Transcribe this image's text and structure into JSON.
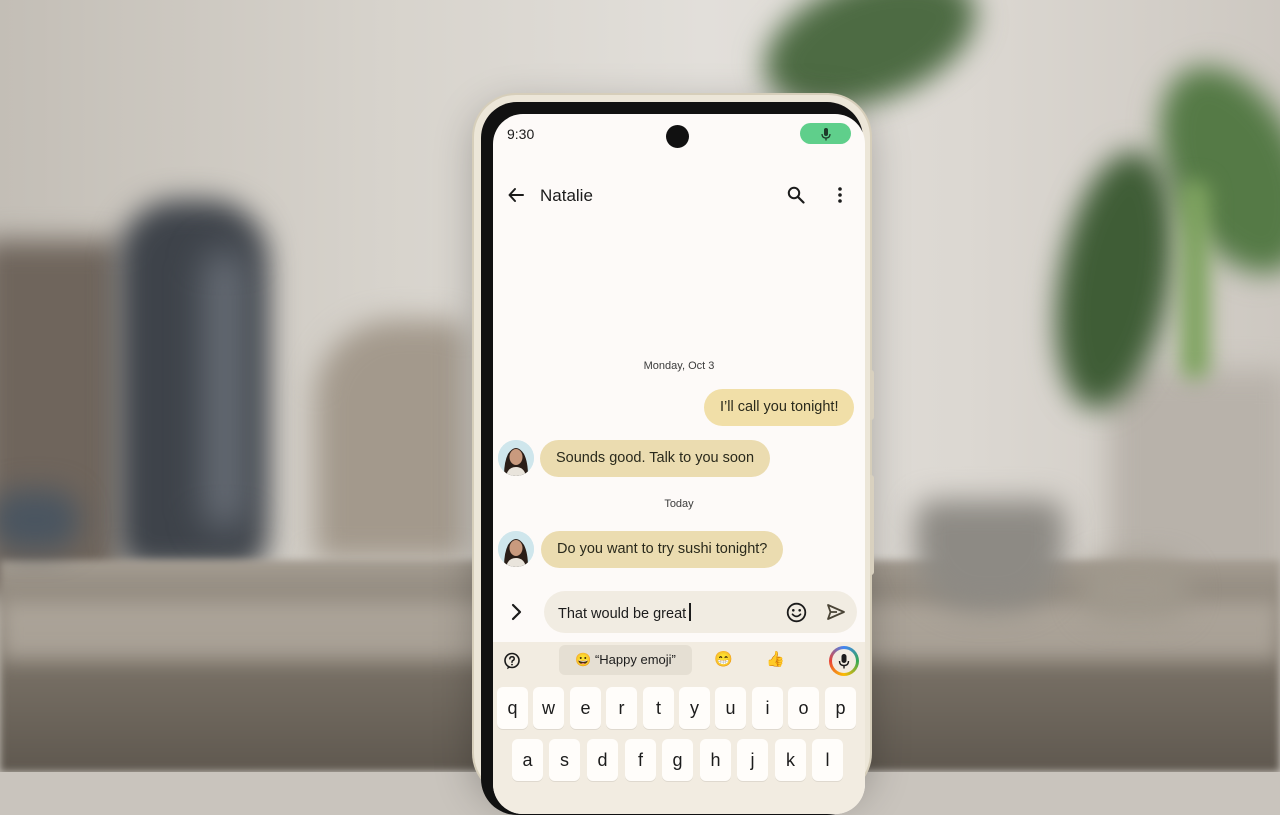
{
  "status_bar": {
    "time": "9:30",
    "mic_indicator": "mic-icon"
  },
  "app_bar": {
    "title": "Natalie",
    "back_icon": "arrow-back-icon",
    "search_icon": "search-icon",
    "more_icon": "more-vert-icon"
  },
  "conversation": {
    "date_1": "Monday, Oct 3",
    "outgoing_1": "I’ll call you tonight!",
    "incoming_1": "Sounds good. Talk to you soon",
    "date_2": "Today",
    "incoming_2": "Do you want to try sushi tonight?"
  },
  "compose": {
    "value": "That would be great",
    "expand_icon": "chevron-right-icon",
    "emoji_icon": "emoji-icon",
    "send_icon": "send-icon"
  },
  "keyboard": {
    "suggestion_chip": "😀 “Happy emoji”",
    "suggestion_emoji_1": "😁",
    "suggestion_emoji_2": "👍",
    "row1": [
      "q",
      "w",
      "e",
      "r",
      "t",
      "y",
      "u",
      "i",
      "o",
      "p"
    ],
    "row2": [
      "a",
      "s",
      "d",
      "f",
      "g",
      "h",
      "j",
      "k",
      "l"
    ]
  },
  "colors": {
    "bubble_outgoing": "#f1dfa8",
    "bubble_incoming": "#ebdcb0",
    "mic_pill": "#5fcf8b"
  }
}
